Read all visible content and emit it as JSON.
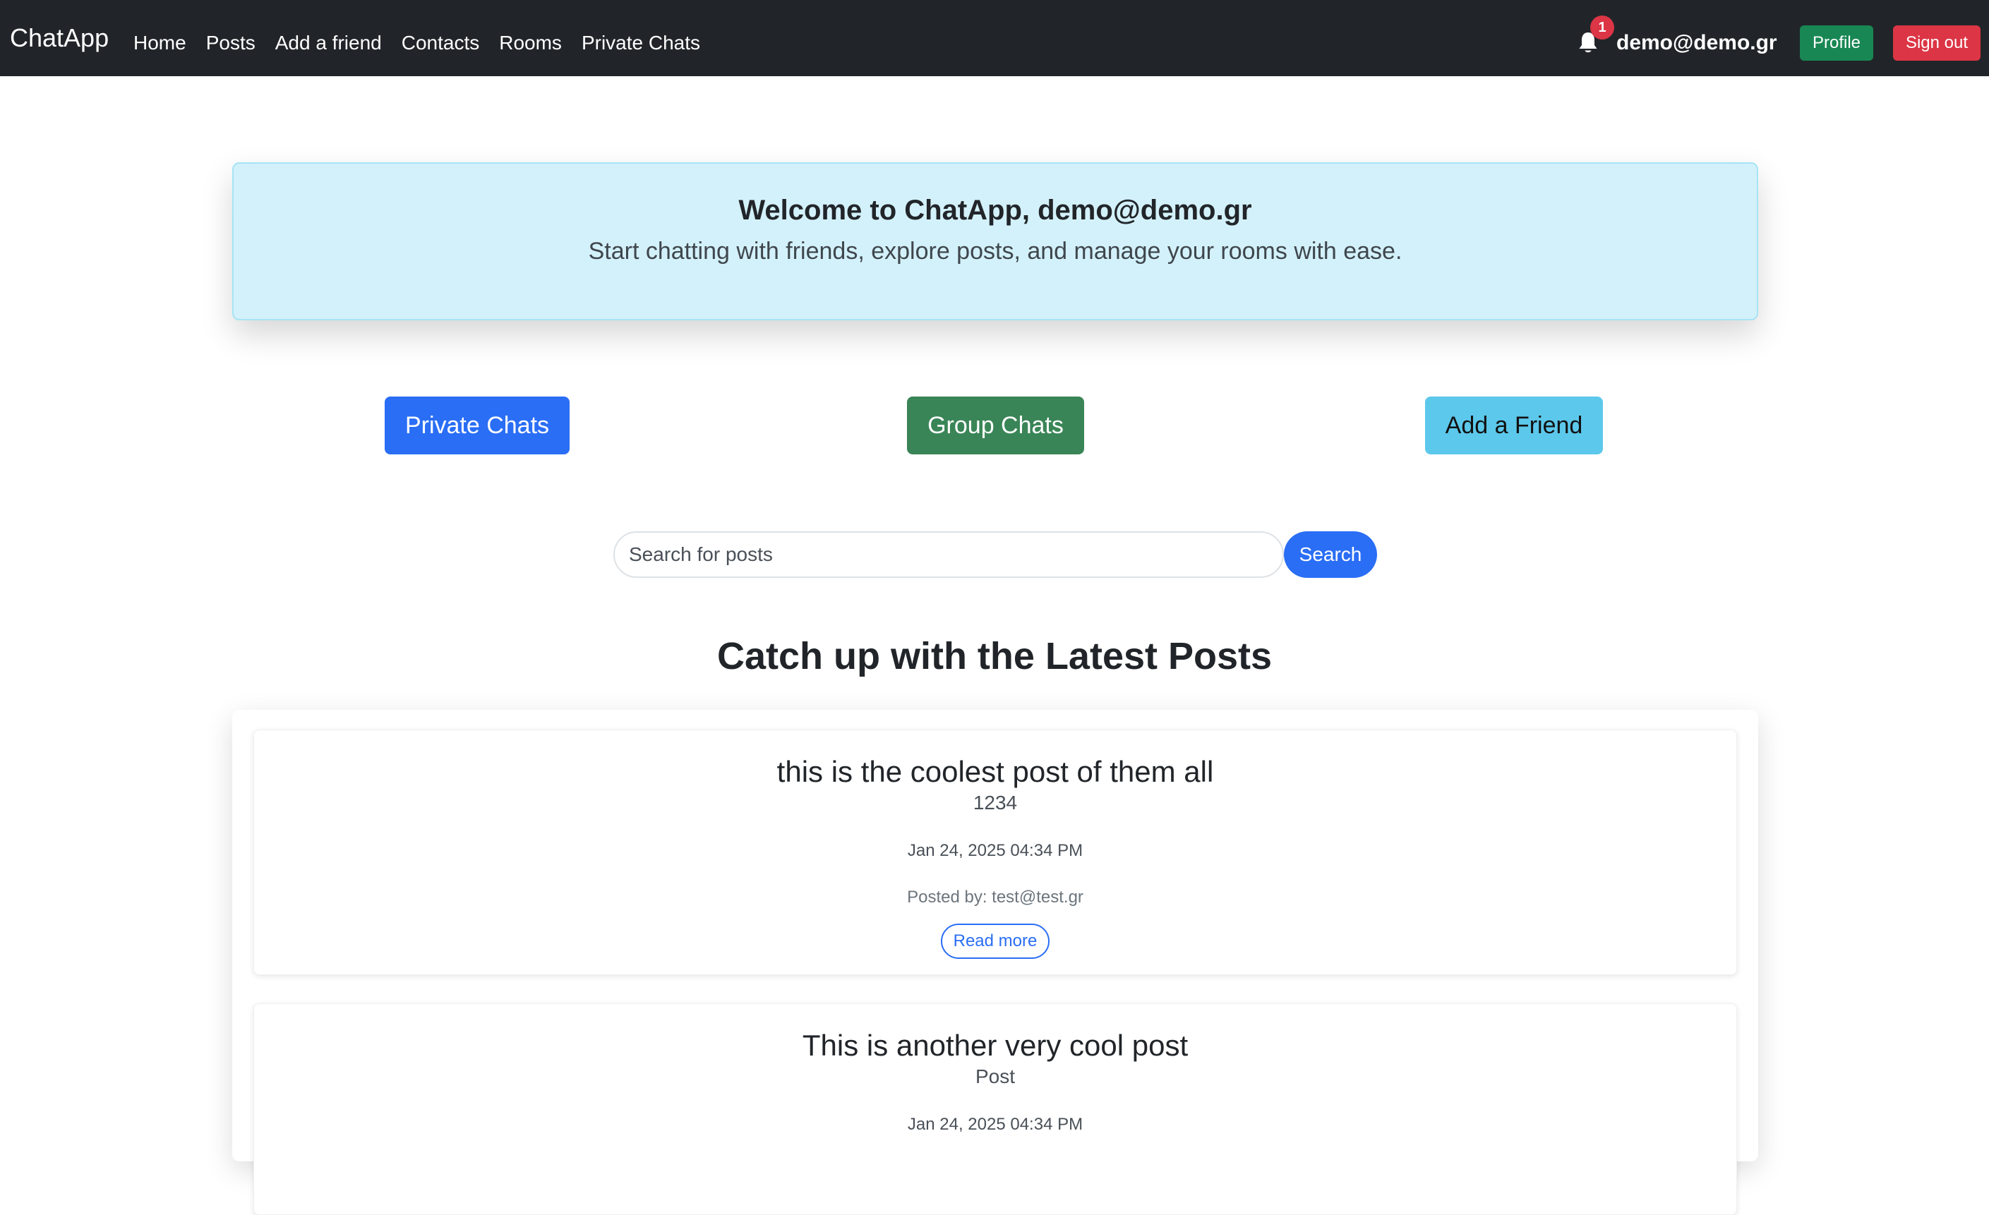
{
  "navbar": {
    "brand": "ChatApp",
    "links": [
      "Home",
      "Posts",
      "Add a friend",
      "Contacts",
      "Rooms",
      "Private Chats"
    ],
    "notification_count": "1",
    "user_email": "demo@demo.gr",
    "profile_label": "Profile",
    "signout_label": "Sign out"
  },
  "welcome": {
    "title": "Welcome to ChatApp, demo@demo.gr",
    "subtitle": "Start chatting with friends, explore posts, and manage your rooms with ease."
  },
  "actions": {
    "private_chats": "Private Chats",
    "group_chats": "Group Chats",
    "add_friend": "Add a Friend"
  },
  "search": {
    "placeholder": "Search for posts",
    "button_label": "Search"
  },
  "posts_section": {
    "title": "Catch up with the Latest Posts"
  },
  "posts": [
    {
      "title": "this is the coolest post of them all",
      "body": "1234",
      "date": "Jan 24, 2025 04:34 PM",
      "author": "Posted by: test@test.gr",
      "read_more": "Read more"
    },
    {
      "title": "This is another very cool post",
      "body": "Post",
      "date": "Jan 24, 2025 04:34 PM"
    }
  ],
  "colors": {
    "navbar_bg": "#212529",
    "primary": "#2a6ef5",
    "success": "#198754",
    "danger": "#dc3545",
    "info": "#5cc8eb",
    "welcome_bg": "#d3f1fa"
  },
  "icons": {
    "notifications": "bell-icon"
  }
}
